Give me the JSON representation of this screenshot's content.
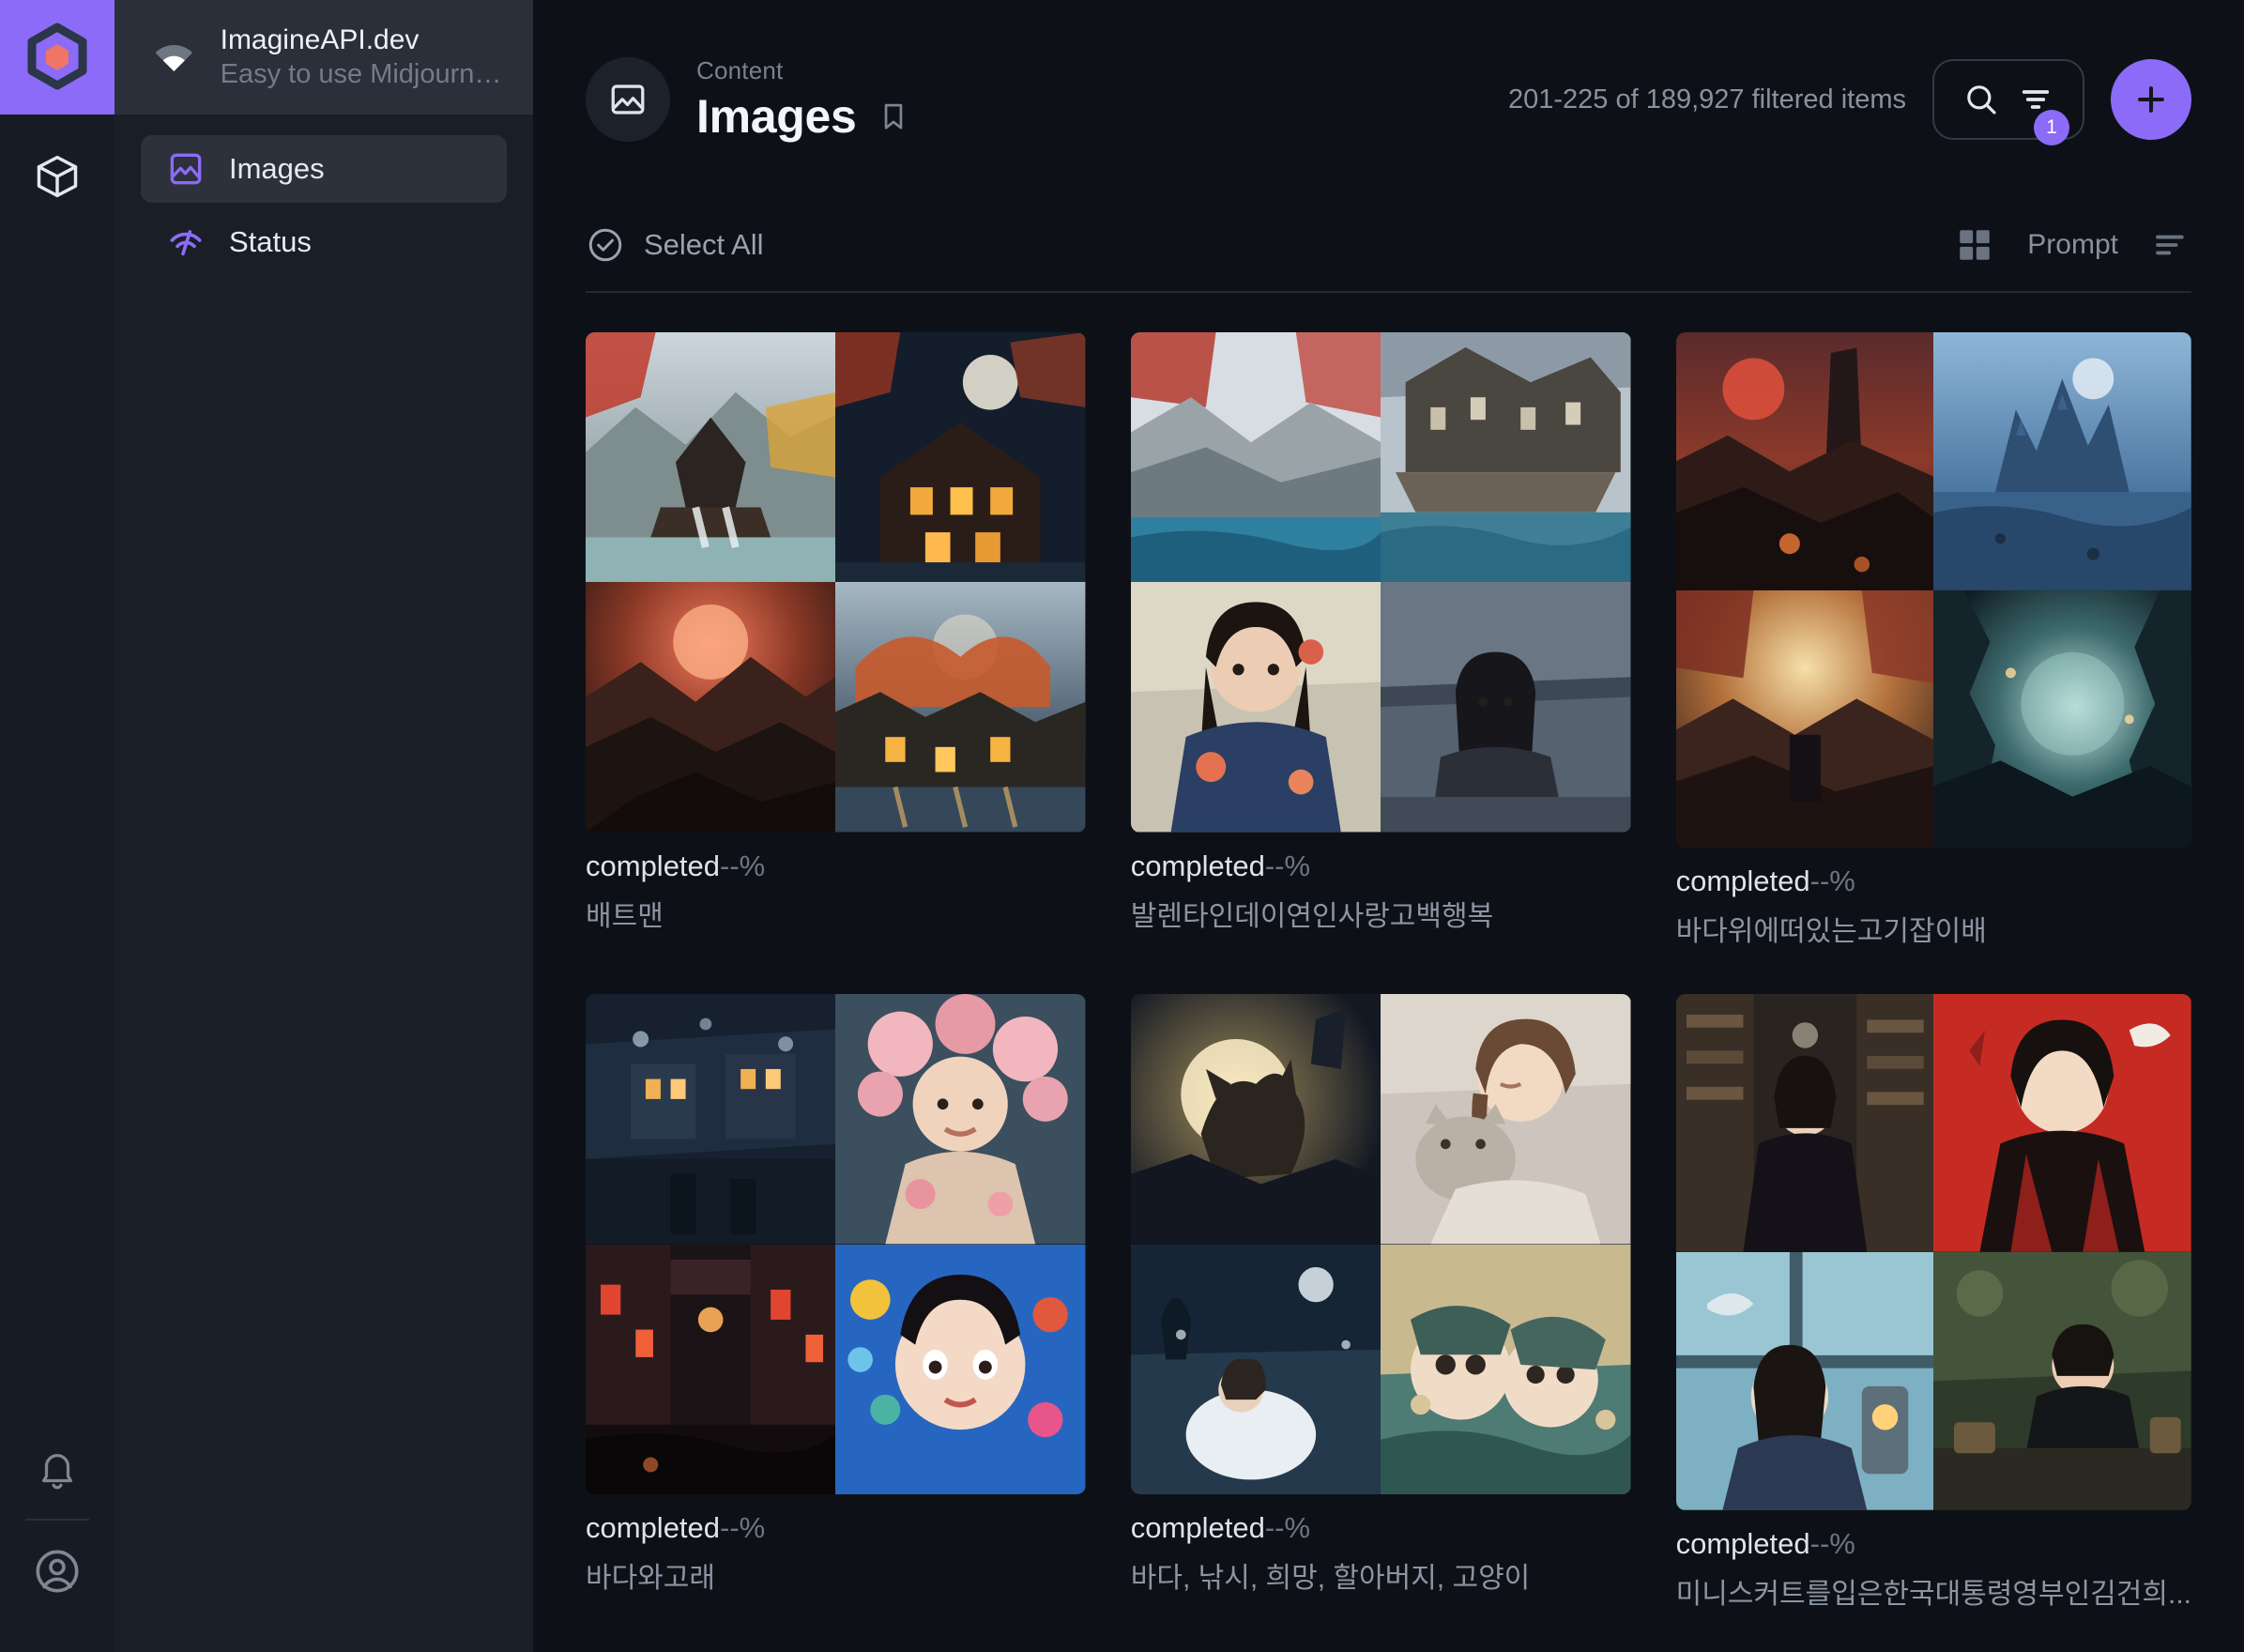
{
  "brand": {
    "name": "ImagineAPI.dev",
    "tagline": "Easy to use Midjourne...",
    "logo_icon": "hexagon-logo-icon",
    "wifi_icon": "wifi-icon",
    "accent_color": "#8b6bf7",
    "logo_inner_color": "#ef7567",
    "logo_outline_color": "#2b3648"
  },
  "rail": {
    "workspace_icon": "cube-icon",
    "notifications_icon": "bell-icon",
    "account_icon": "user-circle-icon"
  },
  "sidebar": {
    "items": [
      {
        "label": "Images",
        "icon": "image-icon",
        "active": true
      },
      {
        "label": "Status",
        "icon": "activity-speedometer-icon",
        "active": false
      }
    ]
  },
  "header": {
    "eyebrow": "Content",
    "title": "Images",
    "page_icon": "image-icon",
    "bookmark_icon": "bookmark-icon",
    "count_text": "201-225 of 189,927 filtered items",
    "search_icon": "search-icon",
    "filter_icon": "filter-icon",
    "filter_badge": "1",
    "add_icon": "plus-icon"
  },
  "toolbar": {
    "select_all_label": "Select All",
    "select_all_icon": "check-circle-icon",
    "grid_view_icon": "grid-view-icon",
    "sort_label": "Prompt",
    "sort_icon": "sort-descending-icon"
  },
  "gallery": {
    "cards": [
      {
        "status": "completed",
        "percent": "--%",
        "prompt": "배트맨",
        "tiles": [
          "pagoda-autumn-waterfall",
          "night-village-lanterns",
          "red-moon-volcanic-valley",
          "autumn-riverside-town"
        ]
      },
      {
        "status": "completed",
        "percent": "--%",
        "prompt": "발렌타인데이연인사랑고백행복",
        "tiles": [
          "red-forest-blue-river",
          "floating-ruined-city",
          "woman-kimono-koi",
          "woman-rainy-platform"
        ]
      },
      {
        "status": "completed",
        "percent": "--%",
        "prompt": "바다위에떠있는고기잡이배",
        "tiles": [
          "red-moon-tower-ruins",
          "blue-ice-castle",
          "sunlit-autumn-canyon",
          "mystic-tree-portal"
        ]
      },
      {
        "status": "completed",
        "percent": "--%",
        "prompt": "바다와고래",
        "tiles": [
          "bokeh-night-street",
          "floral-portrait-woman",
          "neon-alley-rain",
          "surreal-bubble-portrait"
        ]
      },
      {
        "status": "completed",
        "percent": "--%",
        "prompt": "바다, 낚시, 희망, 할아버지, 고양이",
        "tiles": [
          "cat-full-moon-hill",
          "girl-holding-cat",
          "woman-white-dress-sea",
          "two-girls-fish-pattern"
        ]
      },
      {
        "status": "completed",
        "percent": "--%",
        "prompt": "미니스커트를입은한국대통령영부인김건희...",
        "tiles": [
          "library-woman-books",
          "red-backdrop-woman-bird",
          "woman-window-lantern",
          "man-desk-garden"
        ]
      }
    ]
  }
}
